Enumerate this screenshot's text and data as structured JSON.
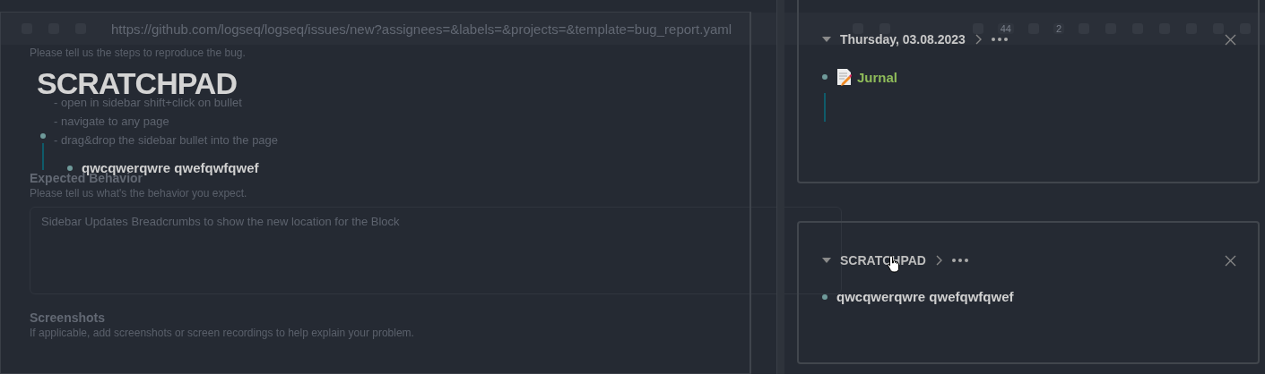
{
  "browser": {
    "url": "https://github.com/logseq/logseq/issues/new?assignees=&labels=&projects=&template=bug_report.yaml",
    "badges": [
      "44",
      "2"
    ]
  },
  "issue_form": {
    "steps_hint": "Please tell us the steps to reproduce the bug.",
    "steps_lines": [
      "- open in sidebar shift+click on bullet",
      "- navigate to any page",
      "- drag&drop the sidebar bullet into the page"
    ],
    "sections": [
      {
        "heading": "Expected Behavior",
        "hint": "Please tell us what's the behavior you expect.",
        "value": "Sidebar Updates Breadcrumbs to show the new location for the Block"
      },
      {
        "heading": "Screenshots",
        "hint": "If applicable, add screenshots or screen recordings to help explain your problem."
      }
    ]
  },
  "main_page": {
    "title": "SCRATCHPAD",
    "blocks": [
      {
        "expanded": true,
        "children": [
          {
            "text": "qwcqwerqwre qwefqwfqwef"
          }
        ]
      }
    ]
  },
  "sidebar": {
    "cards": [
      {
        "title": "Thursday, 03.08.2023",
        "hovered": false,
        "blocks": [
          {
            "kind": "page-ref",
            "text": "Jurnal",
            "expanded": true
          }
        ]
      },
      {
        "title": "SCRATCHPAD",
        "hovered": true,
        "blocks": [
          {
            "kind": "text",
            "text": "qwcqwerqwre qwefqwfqwef",
            "expanded": false
          }
        ]
      }
    ]
  }
}
